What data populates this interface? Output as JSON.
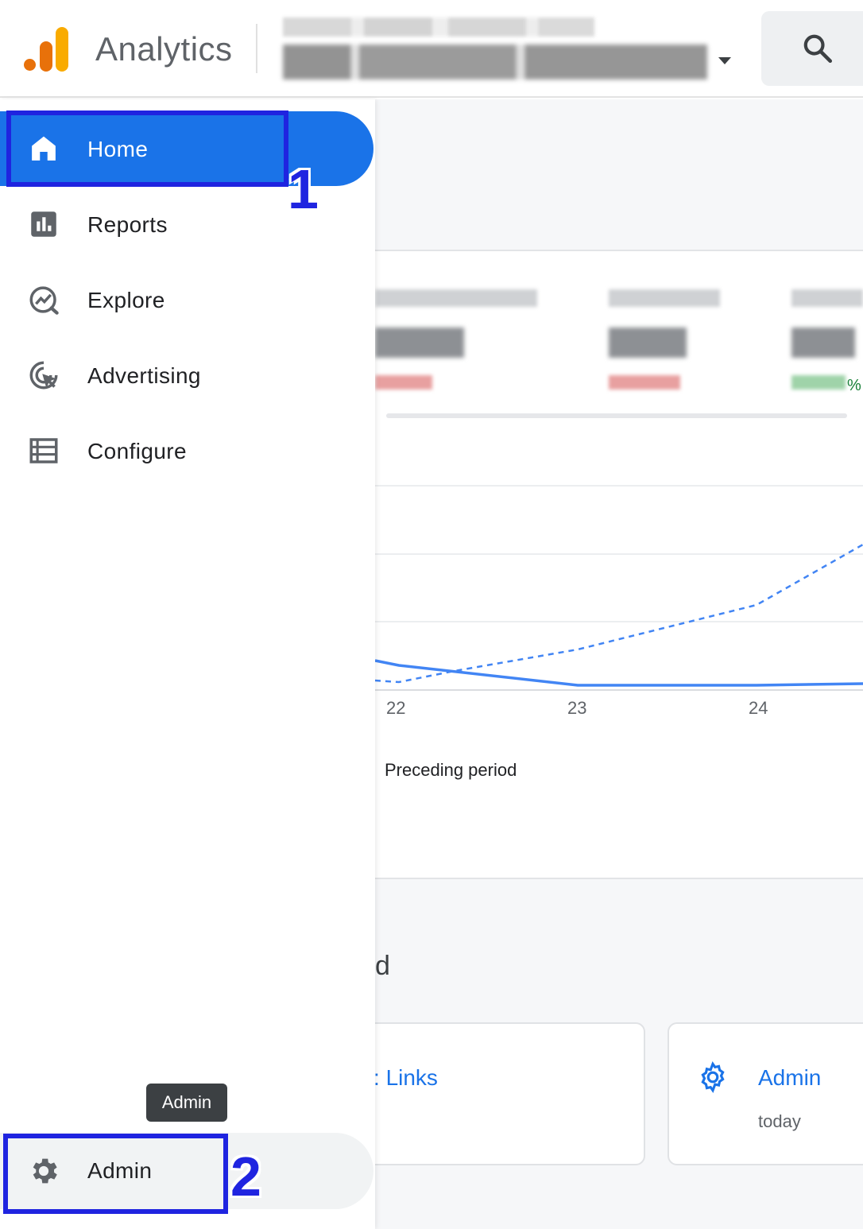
{
  "header": {
    "app_title": "Analytics",
    "search_icon": "search-icon",
    "account_caret_icon": "chevron-down-icon"
  },
  "sidebar": {
    "items": [
      {
        "label": "Home",
        "icon": "home-icon",
        "active": true
      },
      {
        "label": "Reports",
        "icon": "bar-chart-icon"
      },
      {
        "label": "Explore",
        "icon": "explore-icon"
      },
      {
        "label": "Advertising",
        "icon": "advertising-icon"
      },
      {
        "label": "Configure",
        "icon": "configure-list-icon"
      }
    ],
    "admin_label": "Admin",
    "admin_icon": "gear-icon",
    "tooltip": "Admin"
  },
  "main": {
    "metric_pct_suffix": "%",
    "chart_x_ticks": [
      "22",
      "23",
      "24"
    ],
    "legend_label": "Preceding period",
    "section_fragment": "d",
    "quick_cards": [
      {
        "title": "Links",
        "title_prefix": ":"
      },
      {
        "title": "Admin",
        "subtitle": "today",
        "icon": "gear-icon"
      }
    ]
  },
  "annotations": {
    "home_number": "1",
    "admin_number": "2",
    "color": "#1f24e0"
  },
  "colors": {
    "brand_blue": "#1a73e8",
    "logo_orange": "#e8710a",
    "logo_yellow": "#f9ab00",
    "delta_negative": "#d93025",
    "delta_positive": "#188038"
  }
}
